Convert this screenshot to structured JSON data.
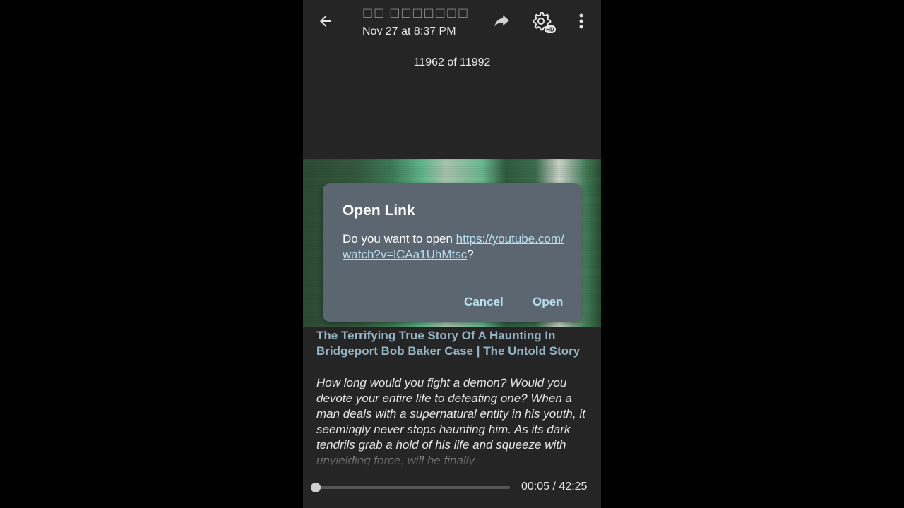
{
  "header": {
    "title": "□□  □□□□□□□□□□□ ▯",
    "subtitle": "Nov 27 at 8:37 PM",
    "counter": "11962 of 11992",
    "icons": {
      "back": "arrow-left-icon",
      "share": "share-forward-icon",
      "settings": "gear-hd-icon",
      "more": "more-vertical-icon"
    },
    "hd_badge": "HD"
  },
  "dialog": {
    "title": "Open Link",
    "body_prefix": "Do you want to open ",
    "link": "https://youtube.com/watch?v=lCAa1UhMtsc",
    "body_suffix": "?",
    "cancel_label": "Cancel",
    "open_label": "Open"
  },
  "post": {
    "title": "The Terrifying True Story Of A Haunting In Bridgeport Bob Baker Case | The Untold Story",
    "description": "How long would you fight a demon? Would you devote your entire life to defeating one? When a man deals with a supernatural entity in his youth, it seemingly never stops haunting him. As its dark tendrils grab a hold of his life and squeeze with unyielding force, will he finally"
  },
  "player": {
    "current_time": "00:05",
    "separator": " / ",
    "duration": "42:25",
    "progress_percent": 0.2
  }
}
